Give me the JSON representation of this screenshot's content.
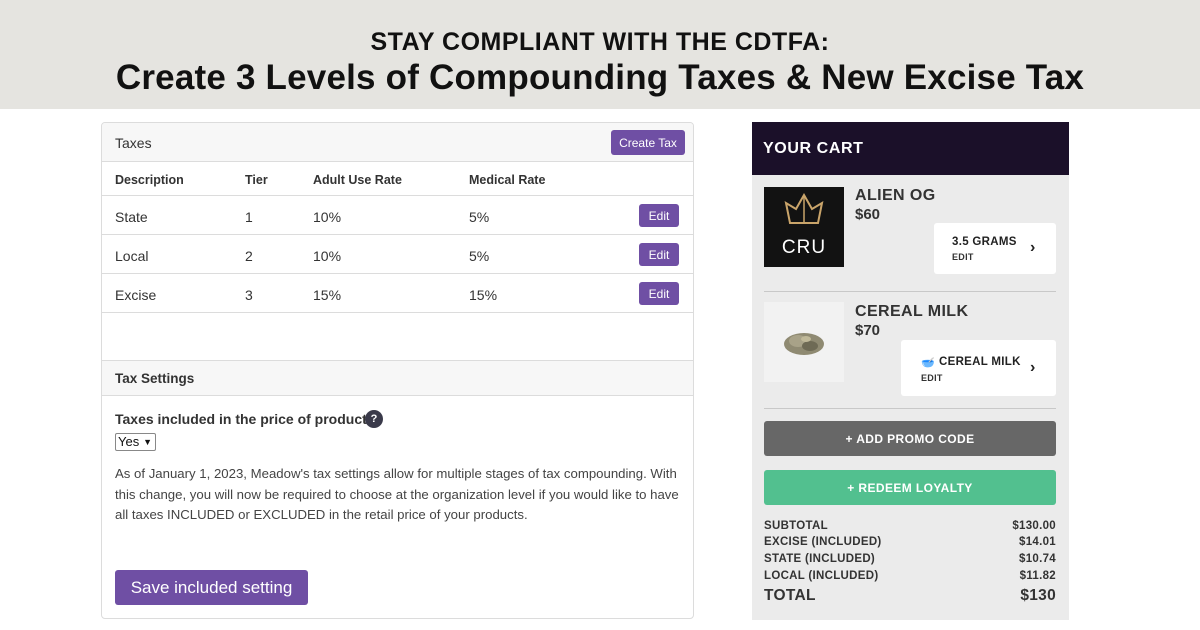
{
  "banner": {
    "eyebrow": "STAY COMPLIANT WITH THE CDTFA:",
    "headline": "Create 3 Levels of Compounding Taxes & New Excise Tax"
  },
  "taxes_panel": {
    "title": "Taxes",
    "create_label": "Create Tax",
    "columns": [
      "Description",
      "Tier",
      "Adult Use Rate",
      "Medical Rate"
    ],
    "rows": [
      {
        "description": "State",
        "tier": "1",
        "adult": "10%",
        "medical": "5%",
        "edit": "Edit"
      },
      {
        "description": "Local",
        "tier": "2",
        "adult": "10%",
        "medical": "5%",
        "edit": "Edit"
      },
      {
        "description": "Excise",
        "tier": "3",
        "adult": "15%",
        "medical": "15%",
        "edit": "Edit"
      }
    ]
  },
  "tax_settings": {
    "title": "Tax Settings",
    "included_label": "Taxes included in the price of products",
    "help_icon": "?",
    "included_value": "Yes",
    "description": "As of January 1, 2023, Meadow's tax settings allow for multiple stages of tax compounding. With this change, you will now be required to choose at the organization level if you would like to have all taxes INCLUDED or EXCLUDED in the retail price of your products.",
    "save_label": "Save included setting"
  },
  "cart": {
    "title": "YOUR CART",
    "items": [
      {
        "brand_logo_text": "CRU",
        "name": "ALIEN OG",
        "price": "$60",
        "option": "3.5 GRAMS",
        "option_edit": "EDIT"
      },
      {
        "name": "CEREAL MILK",
        "price": "$70",
        "option": "CEREAL MILK",
        "option_edit": "EDIT"
      }
    ],
    "promo_label": "+ ADD PROMO CODE",
    "loyalty_label": "+ REDEEM LOYALTY",
    "totals": [
      {
        "label": "SUBTOTAL",
        "value": "$130.00"
      },
      {
        "label": "EXCISE (INCLUDED)",
        "value": "$14.01"
      },
      {
        "label": "STATE (INCLUDED)",
        "value": "$10.74"
      },
      {
        "label": "LOCAL (INCLUDED)",
        "value": "$11.82"
      }
    ],
    "total": {
      "label": "TOTAL",
      "value": "$130"
    }
  },
  "colors": {
    "brand_purple": "#6f4fa4",
    "cart_header": "#1b1029",
    "loyalty_green": "#52c08f",
    "promo_gray": "#676767"
  }
}
